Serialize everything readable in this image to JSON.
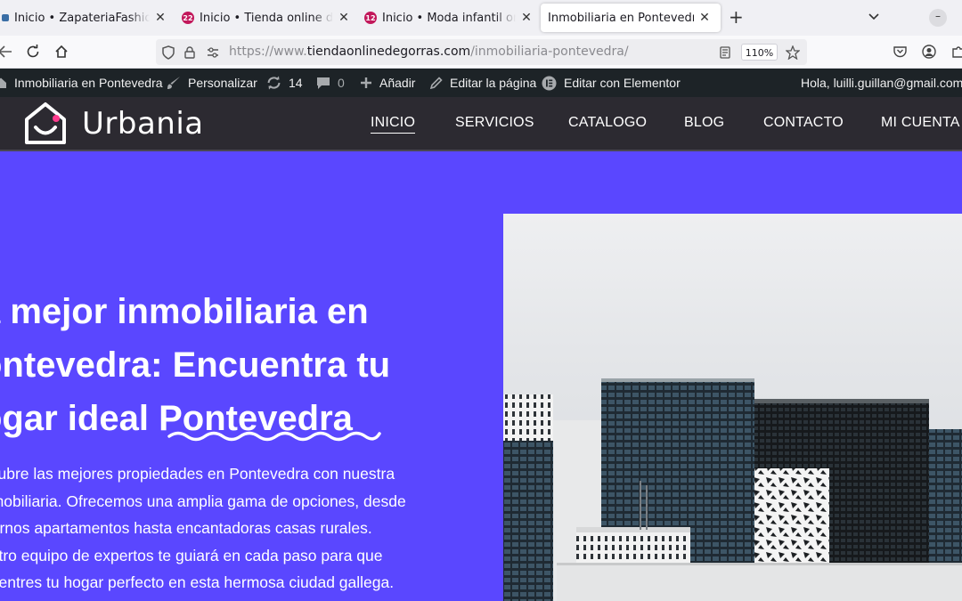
{
  "browser": {
    "tabs": [
      {
        "title": "Inicio • ZapateriaFashion",
        "favicon": "ZF",
        "active": false
      },
      {
        "title": "Inicio • Tienda online de gorras",
        "favicon": "22",
        "active": false
      },
      {
        "title": "Inicio • Moda infantil online",
        "favicon": "12",
        "active": false
      },
      {
        "title": "Inmobiliaria en Pontevedra",
        "favicon": "",
        "active": true
      }
    ],
    "url_prefix": "https://www.",
    "url_host": "tiendaonlinedegorras.com",
    "url_path": "/inmobiliaria-pontevedra/",
    "zoom": "110%"
  },
  "adminbar": {
    "site_name": "Inmobiliaria en Pontevedra",
    "customize": "Personalizar",
    "updates": "14",
    "comments": "0",
    "add_new": "Añadir",
    "edit_page": "Editar la página",
    "elementor": "Editar con Elementor",
    "greeting": "Hola, luilli.guillan@gmail.com"
  },
  "site": {
    "logo_text": "Urbania",
    "menu": [
      "INICIO",
      "SERVICIOS",
      "CATALOGO",
      "BLOG",
      "CONTACTO",
      "MI CUENTA"
    ],
    "accent": "#5a47ff"
  },
  "hero": {
    "title_lines": [
      "a mejor inmobiliaria en",
      "ontevedra: Encuentra tu",
      "ogar ideal"
    ],
    "title_highlight": "Pontevedra",
    "desc_lines": [
      "scubre las mejores propiedades en Pontevedra con nuestra",
      "nmobiliaria. Ofrecemos una amplia gama de opciones, desde",
      "dernos apartamentos hasta encantadoras casas rurales.",
      "estro equipo de expertos te guiará en cada paso para que",
      "cuentres tu hogar perfecto en esta hermosa ciudad gallega."
    ]
  }
}
